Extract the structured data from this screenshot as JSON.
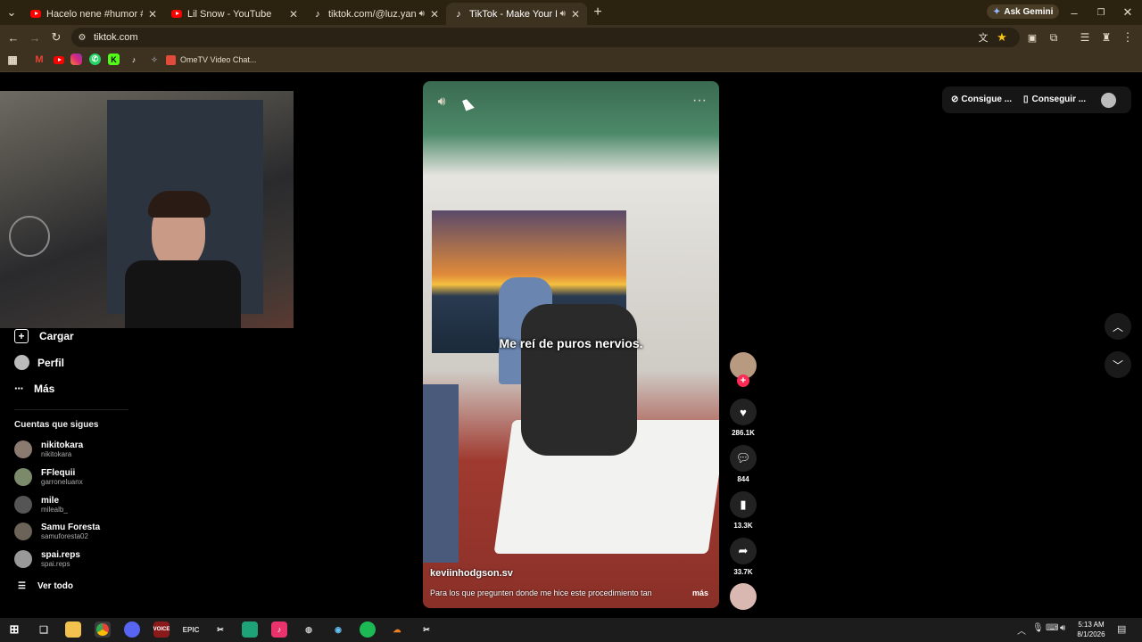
{
  "browser": {
    "tabs": [
      {
        "title": "Hacelo nene #humor #memes",
        "favicon": "youtube-icon",
        "muted": false
      },
      {
        "title": "Lil Snow - YouTube",
        "favicon": "youtube-icon",
        "muted": false
      },
      {
        "title": "tiktok.com/@luz.yancovich",
        "favicon": "tiktok-icon",
        "muted": true
      },
      {
        "title": "TikTok - Make Your Day",
        "favicon": "tiktok-icon",
        "muted": true,
        "active": true
      }
    ],
    "ask_gemini": "Ask Gemini",
    "address": "tiktok.com",
    "bookmark_label": "OmeTV Video Chat..."
  },
  "sidebar": {
    "items": [
      {
        "label": "Cargar",
        "icon": "upload-icon"
      },
      {
        "label": "Perfil",
        "icon": "profile-avatar-icon"
      },
      {
        "label": "Más",
        "icon": "more-icon"
      }
    ],
    "following_title": "Cuentas que sigues",
    "accounts": [
      {
        "name": "nikitokara",
        "handle": "nikitokara"
      },
      {
        "name": "FFlequii",
        "handle": "garroneluanx"
      },
      {
        "name": "mile",
        "handle": "milealb_"
      },
      {
        "name": "Samu Foresta",
        "handle": "samuforesta02"
      },
      {
        "name": "spai.reps",
        "handle": "spai.reps"
      }
    ],
    "see_all": "Ver todo"
  },
  "header": {
    "get_coins": "Consigue ...",
    "get_app": "Conseguir ..."
  },
  "video": {
    "caption": "Me reí de puros nervios.",
    "author": "keviinhodgson.sv",
    "description": "Para los que pregunten donde me hice este procedimiento tan",
    "more": "más"
  },
  "actions": {
    "likes": "286.1K",
    "comments": "844",
    "saves": "13.3K",
    "shares": "33.7K"
  },
  "taskbar": {
    "time": "5:13 AM",
    "date": "8/1/2026"
  },
  "colors": {
    "tiktok_red": "#fe2c55",
    "chrome_frame": "#3d3220"
  }
}
